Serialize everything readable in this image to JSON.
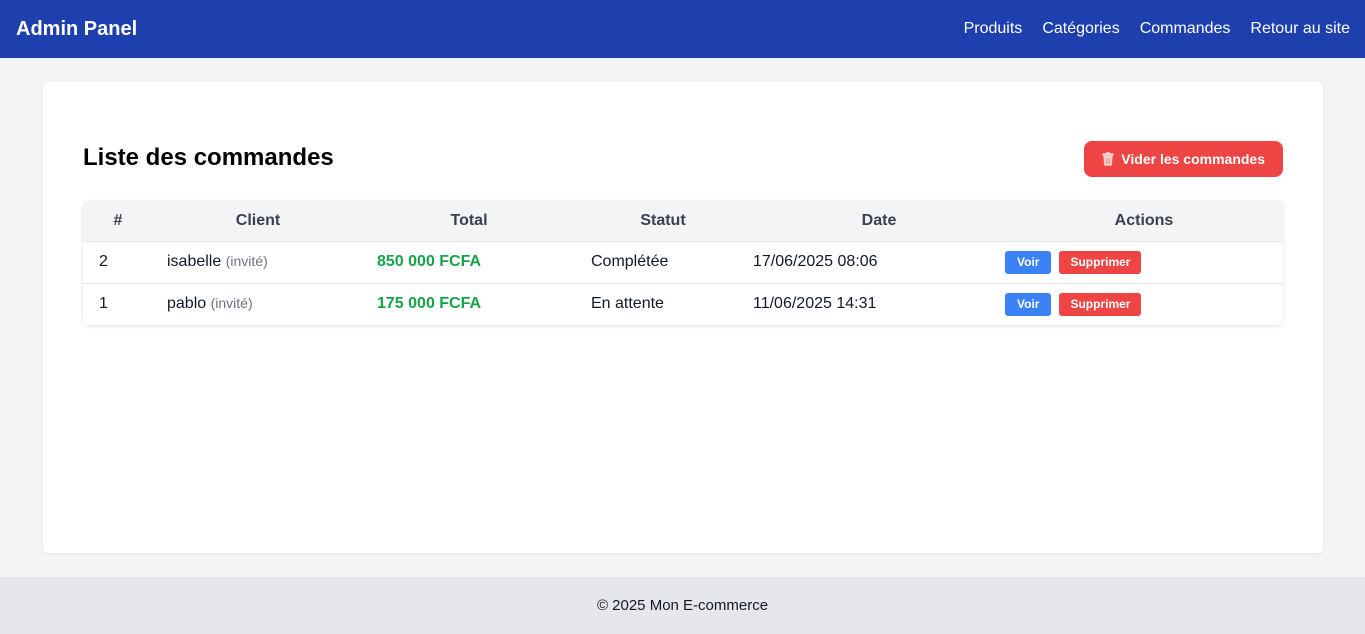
{
  "header": {
    "brand": "Admin Panel",
    "nav": [
      "Produits",
      "Catégories",
      "Commandes",
      "Retour au site"
    ]
  },
  "main": {
    "title": "Liste des commandes",
    "clear_button": "Vider les commandes",
    "table": {
      "columns": [
        "#",
        "Client",
        "Total",
        "Statut",
        "Date",
        "Actions"
      ],
      "rows": [
        {
          "id": "2",
          "client": "isabelle",
          "client_tag": "(invité)",
          "total": "850 000 FCFA",
          "status": "Complétée",
          "date": "17/06/2025 08:06",
          "view": "Voir",
          "delete": "Supprimer"
        },
        {
          "id": "1",
          "client": "pablo",
          "client_tag": "(invité)",
          "total": "175 000 FCFA",
          "status": "En attente",
          "date": "11/06/2025 14:31",
          "view": "Voir",
          "delete": "Supprimer"
        }
      ]
    }
  },
  "footer": {
    "text": "© 2025 Mon E-commerce"
  },
  "colors": {
    "header_bg": "#1e40af",
    "danger": "#ef4444",
    "primary": "#3b82f6",
    "success": "#16a34a"
  },
  "icons": {
    "clear_button_icon": "trash-icon"
  }
}
